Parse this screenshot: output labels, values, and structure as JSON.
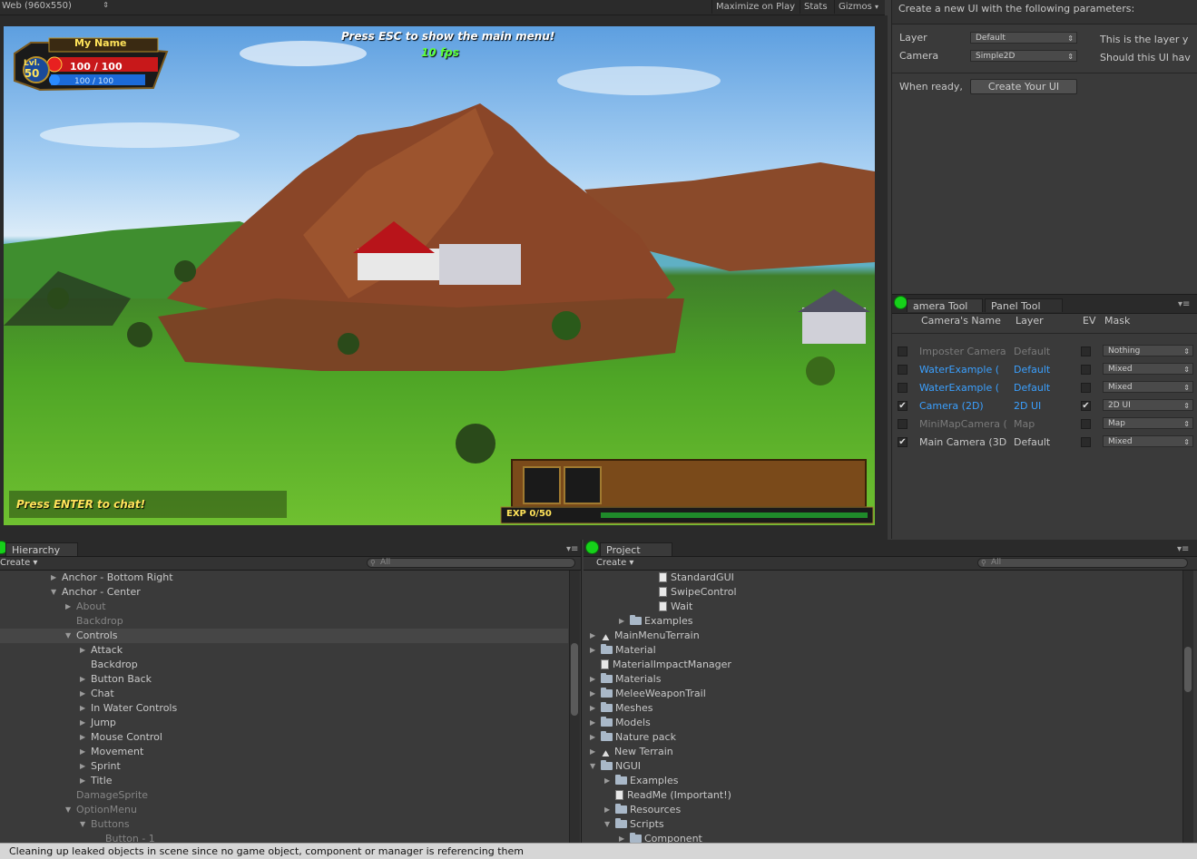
{
  "game": {
    "toolbar": {
      "aspect": "Web (960x550)",
      "maximize": "Maximize on Play",
      "stats": "Stats",
      "gizmos": "Gizmos"
    },
    "hud": {
      "player_name": "My Name",
      "level_label": "Lvl.",
      "level": "50",
      "hp": "100 / 100",
      "mp": "100 / 100",
      "esc_message": "Press ESC to show the main menu!",
      "fps": "10 fps",
      "chat_prompt": "Press ENTER to chat!",
      "exp": "EXP 0/50"
    }
  },
  "create_ui": {
    "header": "Create a new UI with the following parameters:",
    "layer_label": "Layer",
    "layer_value": "Default",
    "camera_label": "Camera",
    "camera_value": "Simple2D",
    "info_line1": "This is the layer y",
    "info_line2": "Should this UI hav",
    "when_ready": "When ready,",
    "create_button": "Create Your UI"
  },
  "camera_tool": {
    "tabs": [
      "amera Tool",
      "Panel Tool"
    ],
    "columns": [
      "Camera's Name",
      "Layer",
      "EV",
      "Mask"
    ],
    "rows": [
      {
        "name": "Imposter Camera",
        "layer": "Default",
        "mask": "Nothing",
        "checked": false,
        "ev": false,
        "style": "dim"
      },
      {
        "name": "WaterExample (",
        "layer": "Default",
        "mask": "Mixed",
        "checked": false,
        "ev": false,
        "style": "blue"
      },
      {
        "name": "WaterExample (",
        "layer": "Default",
        "mask": "Mixed",
        "checked": false,
        "ev": false,
        "style": "blue"
      },
      {
        "name": "Camera (2D)",
        "layer": "2D UI",
        "mask": "2D UI",
        "checked": true,
        "ev": true,
        "style": "blue"
      },
      {
        "name": "MiniMapCamera (",
        "layer": "Map",
        "mask": "Map",
        "checked": false,
        "ev": false,
        "style": "dim"
      },
      {
        "name": "Main Camera (3D",
        "layer": "Default",
        "mask": "Mixed",
        "checked": true,
        "ev": false,
        "style": "normal"
      }
    ]
  },
  "hierarchy": {
    "tab": "Hierarchy",
    "create": "Create",
    "search": "All",
    "items": [
      {
        "label": "Anchor - Bottom Right",
        "indent": 0,
        "arrow": "right"
      },
      {
        "label": "Anchor - Center",
        "indent": 0,
        "arrow": "down"
      },
      {
        "label": "About",
        "indent": 1,
        "arrow": "right",
        "dim": true
      },
      {
        "label": "Backdrop",
        "indent": 1,
        "arrow": "none",
        "dim": true
      },
      {
        "label": "Controls",
        "indent": 1,
        "arrow": "down",
        "selected": true
      },
      {
        "label": "Attack",
        "indent": 2,
        "arrow": "right"
      },
      {
        "label": "Backdrop",
        "indent": 2,
        "arrow": "none"
      },
      {
        "label": "Button Back",
        "indent": 2,
        "arrow": "right"
      },
      {
        "label": "Chat",
        "indent": 2,
        "arrow": "right"
      },
      {
        "label": "In Water Controls",
        "indent": 2,
        "arrow": "right"
      },
      {
        "label": "Jump",
        "indent": 2,
        "arrow": "right"
      },
      {
        "label": "Mouse Control",
        "indent": 2,
        "arrow": "right"
      },
      {
        "label": "Movement",
        "indent": 2,
        "arrow": "right"
      },
      {
        "label": "Sprint",
        "indent": 2,
        "arrow": "right"
      },
      {
        "label": "Title",
        "indent": 2,
        "arrow": "right"
      },
      {
        "label": "DamageSprite",
        "indent": 1,
        "arrow": "none",
        "dim": true
      },
      {
        "label": "OptionMenu",
        "indent": 1,
        "arrow": "down",
        "dim": true
      },
      {
        "label": "Buttons",
        "indent": 2,
        "arrow": "down",
        "dim": true
      },
      {
        "label": "Button - 1",
        "indent": 3,
        "arrow": "none",
        "dim": true
      }
    ]
  },
  "project": {
    "tab": "Project",
    "create": "Create",
    "search": "All",
    "items": [
      {
        "label": "StandardGUI",
        "indent": 4,
        "icon": "file",
        "arrow": "none"
      },
      {
        "label": "SwipeControl",
        "indent": 4,
        "icon": "file",
        "arrow": "none"
      },
      {
        "label": "Wait",
        "indent": 4,
        "icon": "file",
        "arrow": "none"
      },
      {
        "label": "Examples",
        "indent": 2,
        "icon": "folder",
        "arrow": "right"
      },
      {
        "label": "MainMenuTerrain",
        "indent": 0,
        "icon": "scene",
        "arrow": "right"
      },
      {
        "label": "Material",
        "indent": 0,
        "icon": "folder",
        "arrow": "right"
      },
      {
        "label": "MaterialImpactManager",
        "indent": 0,
        "icon": "file",
        "arrow": "none"
      },
      {
        "label": "Materials",
        "indent": 0,
        "icon": "folder",
        "arrow": "right"
      },
      {
        "label": "MeleeWeaponTrail",
        "indent": 0,
        "icon": "folder",
        "arrow": "right"
      },
      {
        "label": "Meshes",
        "indent": 0,
        "icon": "folder",
        "arrow": "right"
      },
      {
        "label": "Models",
        "indent": 0,
        "icon": "folder",
        "arrow": "right"
      },
      {
        "label": "Nature pack",
        "indent": 0,
        "icon": "folder",
        "arrow": "right"
      },
      {
        "label": "New Terrain",
        "indent": 0,
        "icon": "scene",
        "arrow": "right"
      },
      {
        "label": "NGUI",
        "indent": 0,
        "icon": "folder",
        "arrow": "down"
      },
      {
        "label": "Examples",
        "indent": 1,
        "icon": "folder",
        "arrow": "right"
      },
      {
        "label": "ReadMe (Important!)",
        "indent": 1,
        "icon": "file",
        "arrow": "none"
      },
      {
        "label": "Resources",
        "indent": 1,
        "icon": "folder",
        "arrow": "right"
      },
      {
        "label": "Scripts",
        "indent": 1,
        "icon": "folder",
        "arrow": "down"
      },
      {
        "label": "Component",
        "indent": 2,
        "icon": "folder",
        "arrow": "right"
      }
    ]
  },
  "status": {
    "message": "Cleaning up leaked objects in scene since no game object, component or manager is referencing them"
  }
}
